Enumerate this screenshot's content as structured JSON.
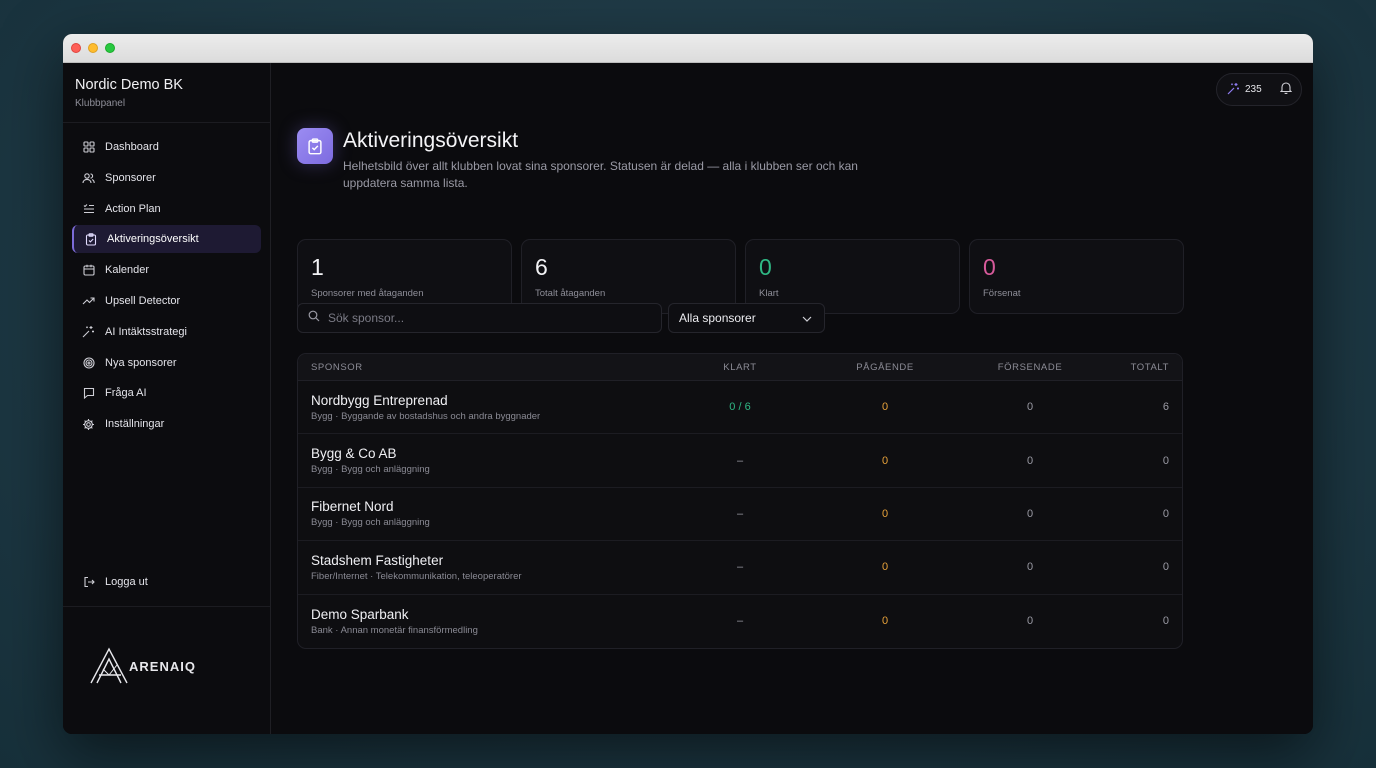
{
  "club": {
    "name": "Nordic Demo BK",
    "subtitle": "Klubbpanel"
  },
  "nav": [
    {
      "label": "Dashboard",
      "icon": "grid-icon",
      "active": false
    },
    {
      "label": "Sponsorer",
      "icon": "users-icon",
      "active": false
    },
    {
      "label": "Action Plan",
      "icon": "list-check-icon",
      "active": false
    },
    {
      "label": "Aktiveringsöversikt",
      "icon": "clipboard-check-icon",
      "active": true
    },
    {
      "label": "Kalender",
      "icon": "calendar-icon",
      "active": false
    },
    {
      "label": "Upsell Detector",
      "icon": "trending-up-icon",
      "active": false
    },
    {
      "label": "AI Intäktsstrategi",
      "icon": "sparkles-icon",
      "active": false
    },
    {
      "label": "Nya sponsorer",
      "icon": "target-icon",
      "active": false
    },
    {
      "label": "Fråga AI",
      "icon": "chat-icon",
      "active": false
    },
    {
      "label": "Inställningar",
      "icon": "gear-icon",
      "active": false
    }
  ],
  "logout_label": "Logga ut",
  "logo_text": "ARENAIQ",
  "topbar": {
    "credits": "235"
  },
  "page": {
    "title": "Aktiveringsöversikt",
    "description": "Helhetsbild över allt klubben lovat sina sponsorer. Statusen är delad — alla i klubben ser och kan uppdatera samma lista."
  },
  "stats": [
    {
      "value": "1",
      "label": "Sponsorer med åtaganden",
      "tone": "default"
    },
    {
      "value": "6",
      "label": "Totalt åtaganden",
      "tone": "default"
    },
    {
      "value": "0",
      "label": "Klart",
      "tone": "green"
    },
    {
      "value": "0",
      "label": "Försenat",
      "tone": "pink"
    }
  ],
  "search": {
    "placeholder": "Sök sponsor..."
  },
  "filter": {
    "selected": "Alla sponsorer"
  },
  "table": {
    "headers": {
      "sponsor": "SPONSOR",
      "klart": "KLART",
      "pagaende": "PÅGÅENDE",
      "forsenade": "FÖRSENADE",
      "totalt": "TOTALT"
    },
    "rows": [
      {
        "name": "Nordbygg Entreprenad",
        "category": "Bygg · Byggande av bostadshus och andra byggnader",
        "klart": "0 / 6",
        "pagaende": "0",
        "forsenade": "0",
        "totalt": "6"
      },
      {
        "name": "Bygg & Co AB",
        "category": "Bygg · Bygg och anläggning",
        "klart": "–",
        "pagaende": "0",
        "forsenade": "0",
        "totalt": "0"
      },
      {
        "name": "Fibernet Nord",
        "category": "Bygg · Bygg och anläggning",
        "klart": "–",
        "pagaende": "0",
        "forsenade": "0",
        "totalt": "0"
      },
      {
        "name": "Stadshem Fastigheter",
        "category": "Fiber/Internet · Telekommunikation, teleoperatörer",
        "klart": "–",
        "pagaende": "0",
        "forsenade": "0",
        "totalt": "0"
      },
      {
        "name": "Demo Sparbank",
        "category": "Bank · Annan monetär finansförmedling",
        "klart": "–",
        "pagaende": "0",
        "forsenade": "0",
        "totalt": "0"
      }
    ]
  },
  "colors": {
    "accent": "#7c6bd8",
    "green": "#2fb784",
    "orange": "#e8a23a",
    "pink": "#d65a9a"
  }
}
